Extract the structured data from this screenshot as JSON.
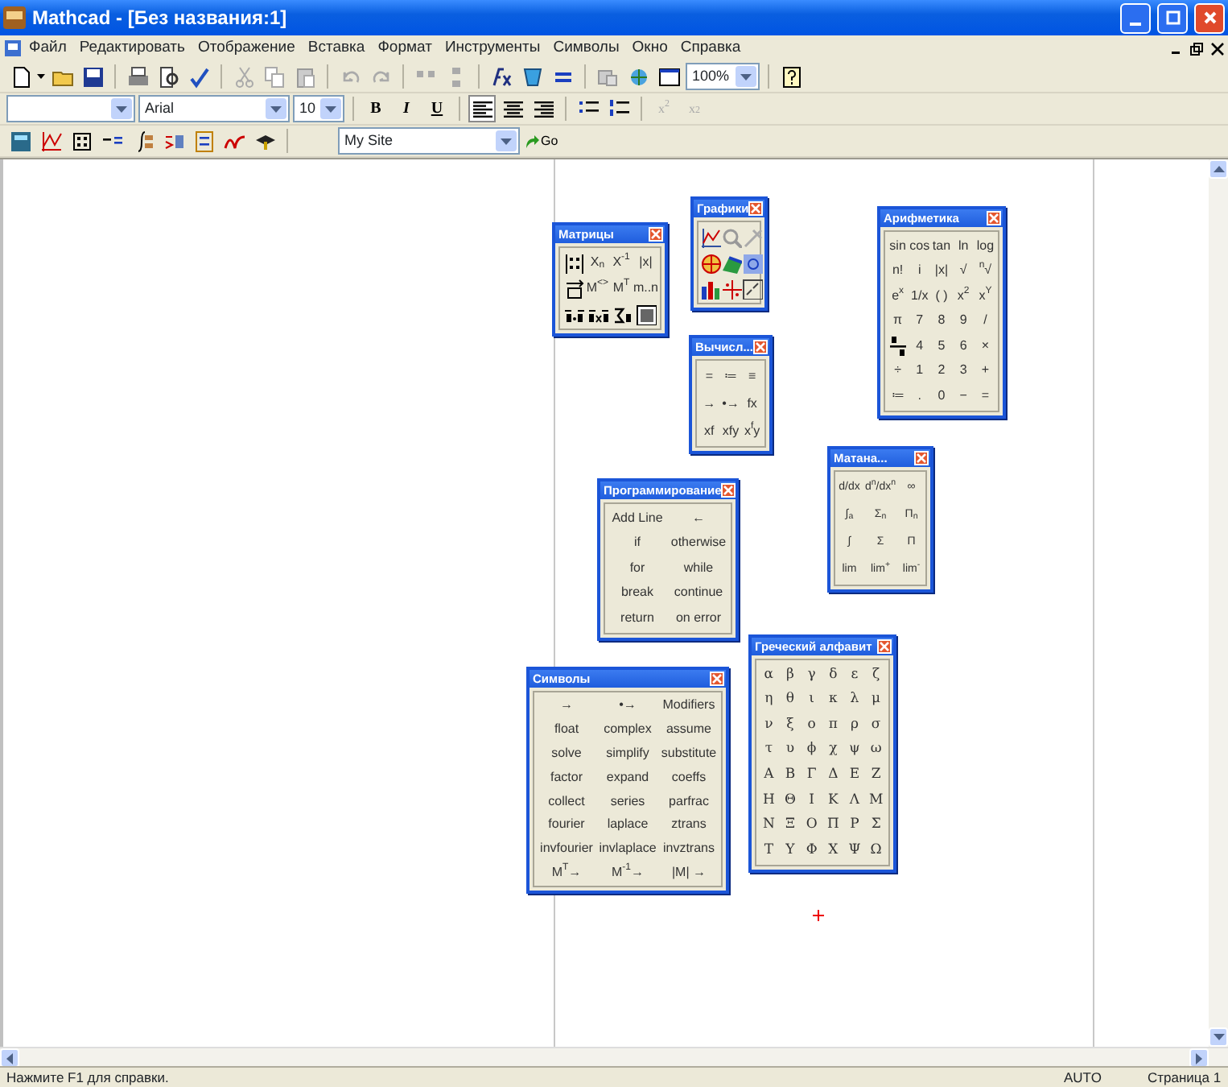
{
  "window": {
    "title": "Mathcad - [Без названия:1]"
  },
  "menu": [
    "Файл",
    "Редактировать",
    "Отображение",
    "Вставка",
    "Формат",
    "Инструменты",
    "Символы",
    "Окно",
    "Справка"
  ],
  "standard_toolbar": {
    "zoom": "100%"
  },
  "formatting_toolbar": {
    "font": "Arial",
    "size": "10",
    "format_buttons": [
      {
        "label": "B"
      },
      {
        "label": "I"
      },
      {
        "label": "U"
      }
    ],
    "alignment": [
      {
        "selected": true
      },
      {
        "selected": false
      },
      {
        "selected": false
      }
    ],
    "script_buttons": [
      {
        "label": "x$^{2}$",
        "disabled": true
      },
      {
        "label": "x$_{2}$",
        "disabled": true
      }
    ]
  },
  "resources_toolbar": {
    "site": "My Site",
    "go": "Go"
  },
  "palettes": [
    {
      "title": "Графики",
      "items": [
        {
          "kind": "icon"
        },
        {
          "kind": "icon"
        },
        {
          "kind": "icon"
        },
        {
          "kind": "icon"
        },
        {
          "kind": "icon"
        },
        {
          "kind": "icon"
        },
        {
          "kind": "icon"
        },
        {
          "kind": "icon"
        },
        {
          "kind": "icon"
        }
      ]
    },
    {
      "title": "Арифметика",
      "items": [
        {
          "kind": "text",
          "label": "sin"
        },
        {
          "kind": "text",
          "label": "cos"
        },
        {
          "kind": "text",
          "label": "tan"
        },
        {
          "kind": "text",
          "label": "ln"
        },
        {
          "kind": "text",
          "label": "log"
        },
        {
          "kind": "text",
          "label": "n!"
        },
        {
          "kind": "text",
          "label": "i"
        },
        {
          "kind": "text",
          "label": "|x|"
        },
        {
          "kind": "text",
          "label": "√"
        },
        {
          "kind": "text",
          "label": "$^{n}$√"
        },
        {
          "kind": "text",
          "label": "e$^{x}$"
        },
        {
          "kind": "text",
          "label": "1/x"
        },
        {
          "kind": "text",
          "label": "( )"
        },
        {
          "kind": "text",
          "label": "x$^{2}$"
        },
        {
          "kind": "text",
          "label": "x$^{Y}$"
        },
        {
          "kind": "text",
          "label": "π"
        },
        {
          "kind": "text",
          "label": "7"
        },
        {
          "kind": "text",
          "label": "8"
        },
        {
          "kind": "text",
          "label": "9"
        },
        {
          "kind": "text",
          "label": "/"
        },
        {
          "kind": "icon"
        },
        {
          "kind": "text",
          "label": "4"
        },
        {
          "kind": "text",
          "label": "5"
        },
        {
          "kind": "text",
          "label": "6"
        },
        {
          "kind": "text",
          "label": "×"
        },
        {
          "kind": "text",
          "label": "÷"
        },
        {
          "kind": "text",
          "label": "1"
        },
        {
          "kind": "text",
          "label": "2"
        },
        {
          "kind": "text",
          "label": "3"
        },
        {
          "kind": "text",
          "label": "+"
        },
        {
          "kind": "text",
          "label": "≔"
        },
        {
          "kind": "text",
          "label": "."
        },
        {
          "kind": "text",
          "label": "0"
        },
        {
          "kind": "text",
          "label": "−"
        },
        {
          "kind": "text",
          "label": "="
        }
      ]
    },
    {
      "title": "Матрицы",
      "items": [
        {
          "kind": "icon"
        },
        {
          "kind": "text",
          "label": "X$_{n}$"
        },
        {
          "kind": "text",
          "label": "X$^{-1}$"
        },
        {
          "kind": "text",
          "label": "|x|"
        },
        {
          "kind": "icon"
        },
        {
          "kind": "text",
          "label": "M$^{<>}$"
        },
        {
          "kind": "text",
          "label": "M$^{T}$"
        },
        {
          "kind": "text",
          "label": "m..n"
        },
        {
          "kind": "icon"
        },
        {
          "kind": "icon"
        },
        {
          "kind": "icon"
        },
        {
          "kind": "icon"
        }
      ]
    },
    {
      "title": "Вычисл...",
      "items": [
        {
          "kind": "text",
          "label": "="
        },
        {
          "kind": "text",
          "label": "≔"
        },
        {
          "kind": "text",
          "label": "≡"
        },
        {
          "kind": "text",
          "label": "→"
        },
        {
          "kind": "text",
          "label": "•→"
        },
        {
          "kind": "text",
          "label": "fx"
        },
        {
          "kind": "text",
          "label": "xf"
        },
        {
          "kind": "text",
          "label": "xfy"
        },
        {
          "kind": "text",
          "label": "x$^{f}$y"
        }
      ]
    },
    {
      "title": "Матана...",
      "items": [
        {
          "kind": "text",
          "label": "d/dx"
        },
        {
          "kind": "text",
          "label": "d$^{n}$/dx$^{n}$"
        },
        {
          "kind": "text",
          "label": "∞"
        },
        {
          "kind": "text",
          "label": "∫$_{a}$"
        },
        {
          "kind": "text",
          "label": "Σ$_{n}$"
        },
        {
          "kind": "text",
          "label": "Π$_{n}$"
        },
        {
          "kind": "text",
          "label": "∫"
        },
        {
          "kind": "text",
          "label": "Σ"
        },
        {
          "kind": "text",
          "label": "Π"
        },
        {
          "kind": "text",
          "label": "lim"
        },
        {
          "kind": "text",
          "label": "lim$^{+}$"
        },
        {
          "kind": "text",
          "label": "lim$^{-}$"
        }
      ]
    },
    {
      "title": "Программирование",
      "items": [
        {
          "kind": "text",
          "label": "Add Line"
        },
        {
          "kind": "text",
          "label": "←"
        },
        {
          "kind": "text",
          "label": "if"
        },
        {
          "kind": "text",
          "label": "otherwise"
        },
        {
          "kind": "text",
          "label": "for"
        },
        {
          "kind": "text",
          "label": "while"
        },
        {
          "kind": "text",
          "label": "break"
        },
        {
          "kind": "text",
          "label": "continue"
        },
        {
          "kind": "text",
          "label": "return"
        },
        {
          "kind": "text",
          "label": "on error"
        }
      ]
    },
    {
      "title": "Греческий алфавит",
      "items": [
        {
          "kind": "text",
          "label": "α"
        },
        {
          "kind": "text",
          "label": "β"
        },
        {
          "kind": "text",
          "label": "γ"
        },
        {
          "kind": "text",
          "label": "δ"
        },
        {
          "kind": "text",
          "label": "ε"
        },
        {
          "kind": "text",
          "label": "ζ"
        },
        {
          "kind": "text",
          "label": "η"
        },
        {
          "kind": "text",
          "label": "θ"
        },
        {
          "kind": "text",
          "label": "ι"
        },
        {
          "kind": "text",
          "label": "κ"
        },
        {
          "kind": "text",
          "label": "λ"
        },
        {
          "kind": "text",
          "label": "μ"
        },
        {
          "kind": "text",
          "label": "ν"
        },
        {
          "kind": "text",
          "label": "ξ"
        },
        {
          "kind": "text",
          "label": "ο"
        },
        {
          "kind": "text",
          "label": "π"
        },
        {
          "kind": "text",
          "label": "ρ"
        },
        {
          "kind": "text",
          "label": "σ"
        },
        {
          "kind": "text",
          "label": "τ"
        },
        {
          "kind": "text",
          "label": "υ"
        },
        {
          "kind": "text",
          "label": "ϕ"
        },
        {
          "kind": "text",
          "label": "χ"
        },
        {
          "kind": "text",
          "label": "ψ"
        },
        {
          "kind": "text",
          "label": "ω"
        },
        {
          "kind": "text",
          "label": "Α"
        },
        {
          "kind": "text",
          "label": "Β"
        },
        {
          "kind": "text",
          "label": "Γ"
        },
        {
          "kind": "text",
          "label": "Δ"
        },
        {
          "kind": "text",
          "label": "Ε"
        },
        {
          "kind": "text",
          "label": "Ζ"
        },
        {
          "kind": "text",
          "label": "Η"
        },
        {
          "kind": "text",
          "label": "Θ"
        },
        {
          "kind": "text",
          "label": "Ι"
        },
        {
          "kind": "text",
          "label": "Κ"
        },
        {
          "kind": "text",
          "label": "Λ"
        },
        {
          "kind": "text",
          "label": "Μ"
        },
        {
          "kind": "text",
          "label": "Ν"
        },
        {
          "kind": "text",
          "label": "Ξ"
        },
        {
          "kind": "text",
          "label": "Ο"
        },
        {
          "kind": "text",
          "label": "Π"
        },
        {
          "kind": "text",
          "label": "Ρ"
        },
        {
          "kind": "text",
          "label": "Σ"
        },
        {
          "kind": "text",
          "label": "Τ"
        },
        {
          "kind": "text",
          "label": "Υ"
        },
        {
          "kind": "text",
          "label": "Φ"
        },
        {
          "kind": "text",
          "label": "Χ"
        },
        {
          "kind": "text",
          "label": "Ψ"
        },
        {
          "kind": "text",
          "label": "Ω"
        }
      ]
    },
    {
      "title": "Символы",
      "items": [
        {
          "kind": "text",
          "label": "→"
        },
        {
          "kind": "text",
          "label": "•→"
        },
        {
          "kind": "text",
          "label": "Modifiers"
        },
        {
          "kind": "text",
          "label": "float"
        },
        {
          "kind": "text",
          "label": "complex"
        },
        {
          "kind": "text",
          "label": "assume"
        },
        {
          "kind": "text",
          "label": "solve"
        },
        {
          "kind": "text",
          "label": "simplify"
        },
        {
          "kind": "text",
          "label": "substitute"
        },
        {
          "kind": "text",
          "label": "factor"
        },
        {
          "kind": "text",
          "label": "expand"
        },
        {
          "kind": "text",
          "label": "coeffs"
        },
        {
          "kind": "text",
          "label": "collect"
        },
        {
          "kind": "text",
          "label": "series"
        },
        {
          "kind": "text",
          "label": "parfrac"
        },
        {
          "kind": "text",
          "label": "fourier"
        },
        {
          "kind": "text",
          "label": "laplace"
        },
        {
          "kind": "text",
          "label": "ztrans"
        },
        {
          "kind": "text",
          "label": "invfourier"
        },
        {
          "kind": "text",
          "label": "invlaplace"
        },
        {
          "kind": "text",
          "label": "invztrans"
        },
        {
          "kind": "text",
          "label": "M$^{T}$→"
        },
        {
          "kind": "text",
          "label": "M$^{-1}$→"
        },
        {
          "kind": "text",
          "label": "|M| →"
        }
      ]
    }
  ],
  "status_bar": {
    "hint": "Нажмите F1 для справки.",
    "mode": "AUTO",
    "page": "Страница 1"
  }
}
